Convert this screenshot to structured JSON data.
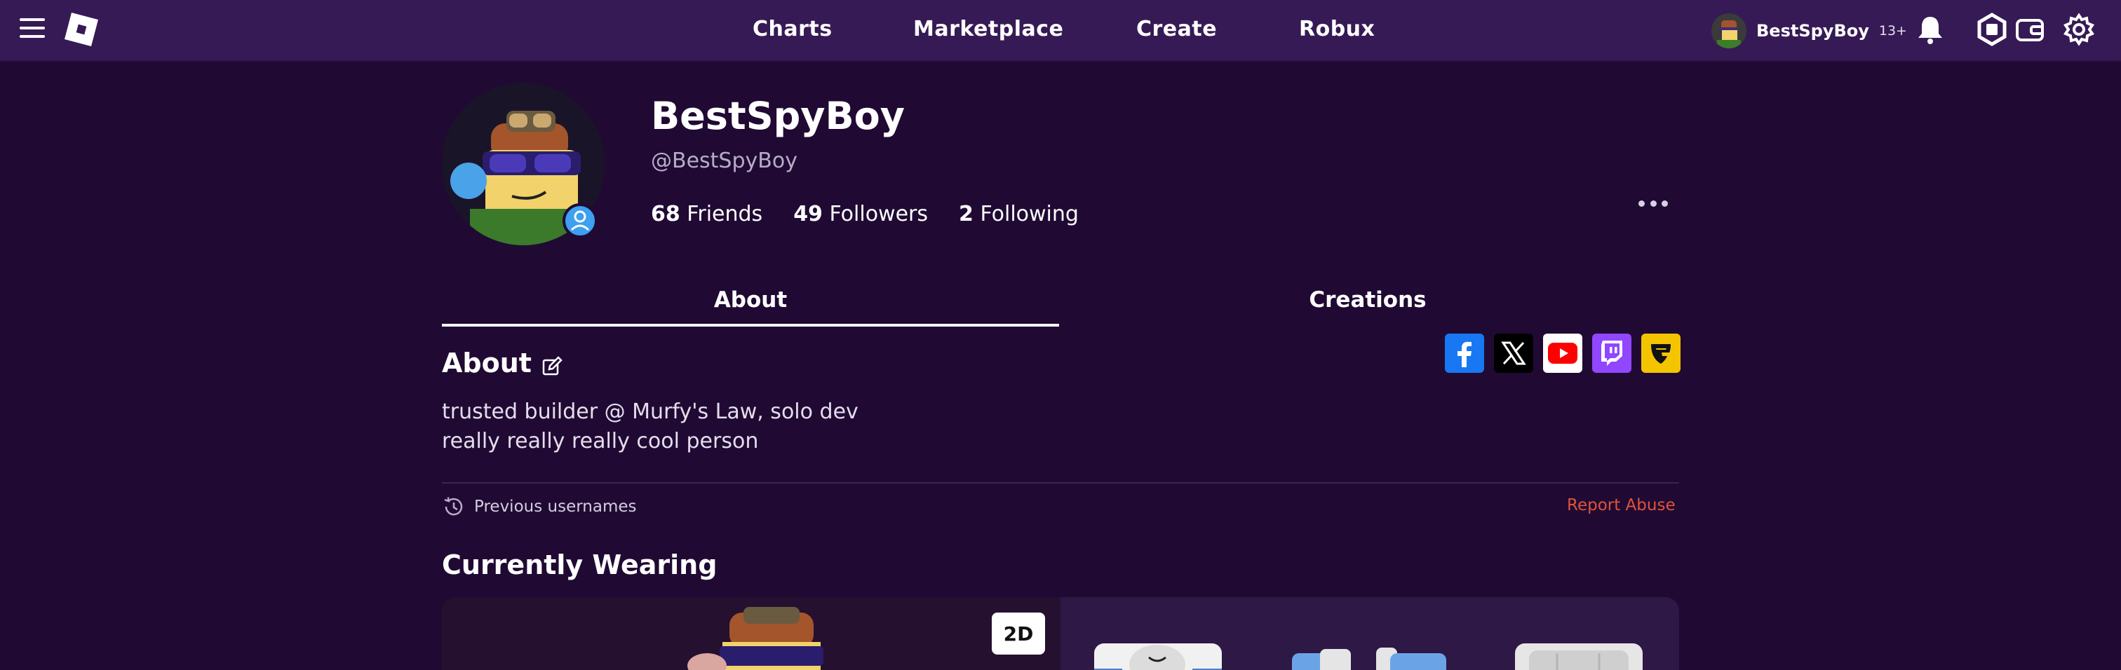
{
  "topbar": {
    "nav": [
      "Charts",
      "Marketplace",
      "Create",
      "Robux"
    ],
    "user": {
      "name": "BestSpyBoy",
      "age_badge": "13+"
    },
    "icons": [
      "menu-icon",
      "roblox-logo",
      "bell-icon",
      "robux-icon",
      "wallet-icon",
      "gear-icon"
    ]
  },
  "profile": {
    "display_name": "BestSpyBoy",
    "handle": "@BestSpyBoy",
    "stats": [
      {
        "count": "68",
        "label": "Friends"
      },
      {
        "count": "49",
        "label": "Followers"
      },
      {
        "count": "2",
        "label": "Following"
      }
    ]
  },
  "tabs": [
    {
      "label": "About",
      "active": true
    },
    {
      "label": "Creations",
      "active": false
    }
  ],
  "about": {
    "title": "About",
    "bio": [
      "trusted builder @ Murfy's Law, solo dev",
      "really really really cool person"
    ],
    "socials": [
      {
        "name": "facebook",
        "color": "#1877f2"
      },
      {
        "name": "x",
        "color": "#000000"
      },
      {
        "name": "youtube",
        "color": "#ffffff"
      },
      {
        "name": "twitch",
        "color": "#9146ff"
      },
      {
        "name": "guilded",
        "color": "#f5c400"
      }
    ],
    "previous_usernames": "Previous usernames",
    "report_abuse": "Report Abuse"
  },
  "wearing": {
    "title": "Currently Wearing",
    "toggle": "2D"
  }
}
